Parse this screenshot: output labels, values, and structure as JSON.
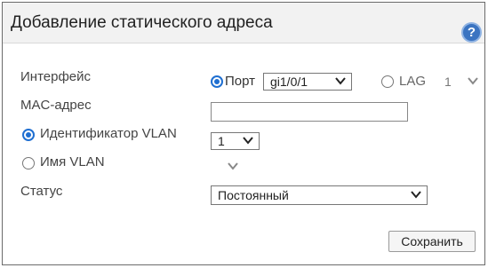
{
  "dialog": {
    "title": "Добавление статического адреса",
    "help_icon": "help-icon"
  },
  "interface": {
    "label": "Интерфейс",
    "port_label": "Порт",
    "port_value": "gi1/0/1",
    "port_selected": true,
    "lag_label": "LAG",
    "lag_value": "1",
    "lag_selected": false
  },
  "mac": {
    "label": "MAC-адрес",
    "value": ""
  },
  "vlan_id": {
    "label": "Идентификатор VLAN",
    "value": "1",
    "selected": true
  },
  "vlan_name": {
    "label": "Имя VLAN",
    "value": "",
    "selected": false
  },
  "status": {
    "label": "Статус",
    "value": "Постоянный"
  },
  "actions": {
    "save_label": "Сохранить"
  },
  "colors": {
    "accent": "#1f6fd1",
    "help": "#3b74c1",
    "header_bg": "#f2f2f2"
  }
}
